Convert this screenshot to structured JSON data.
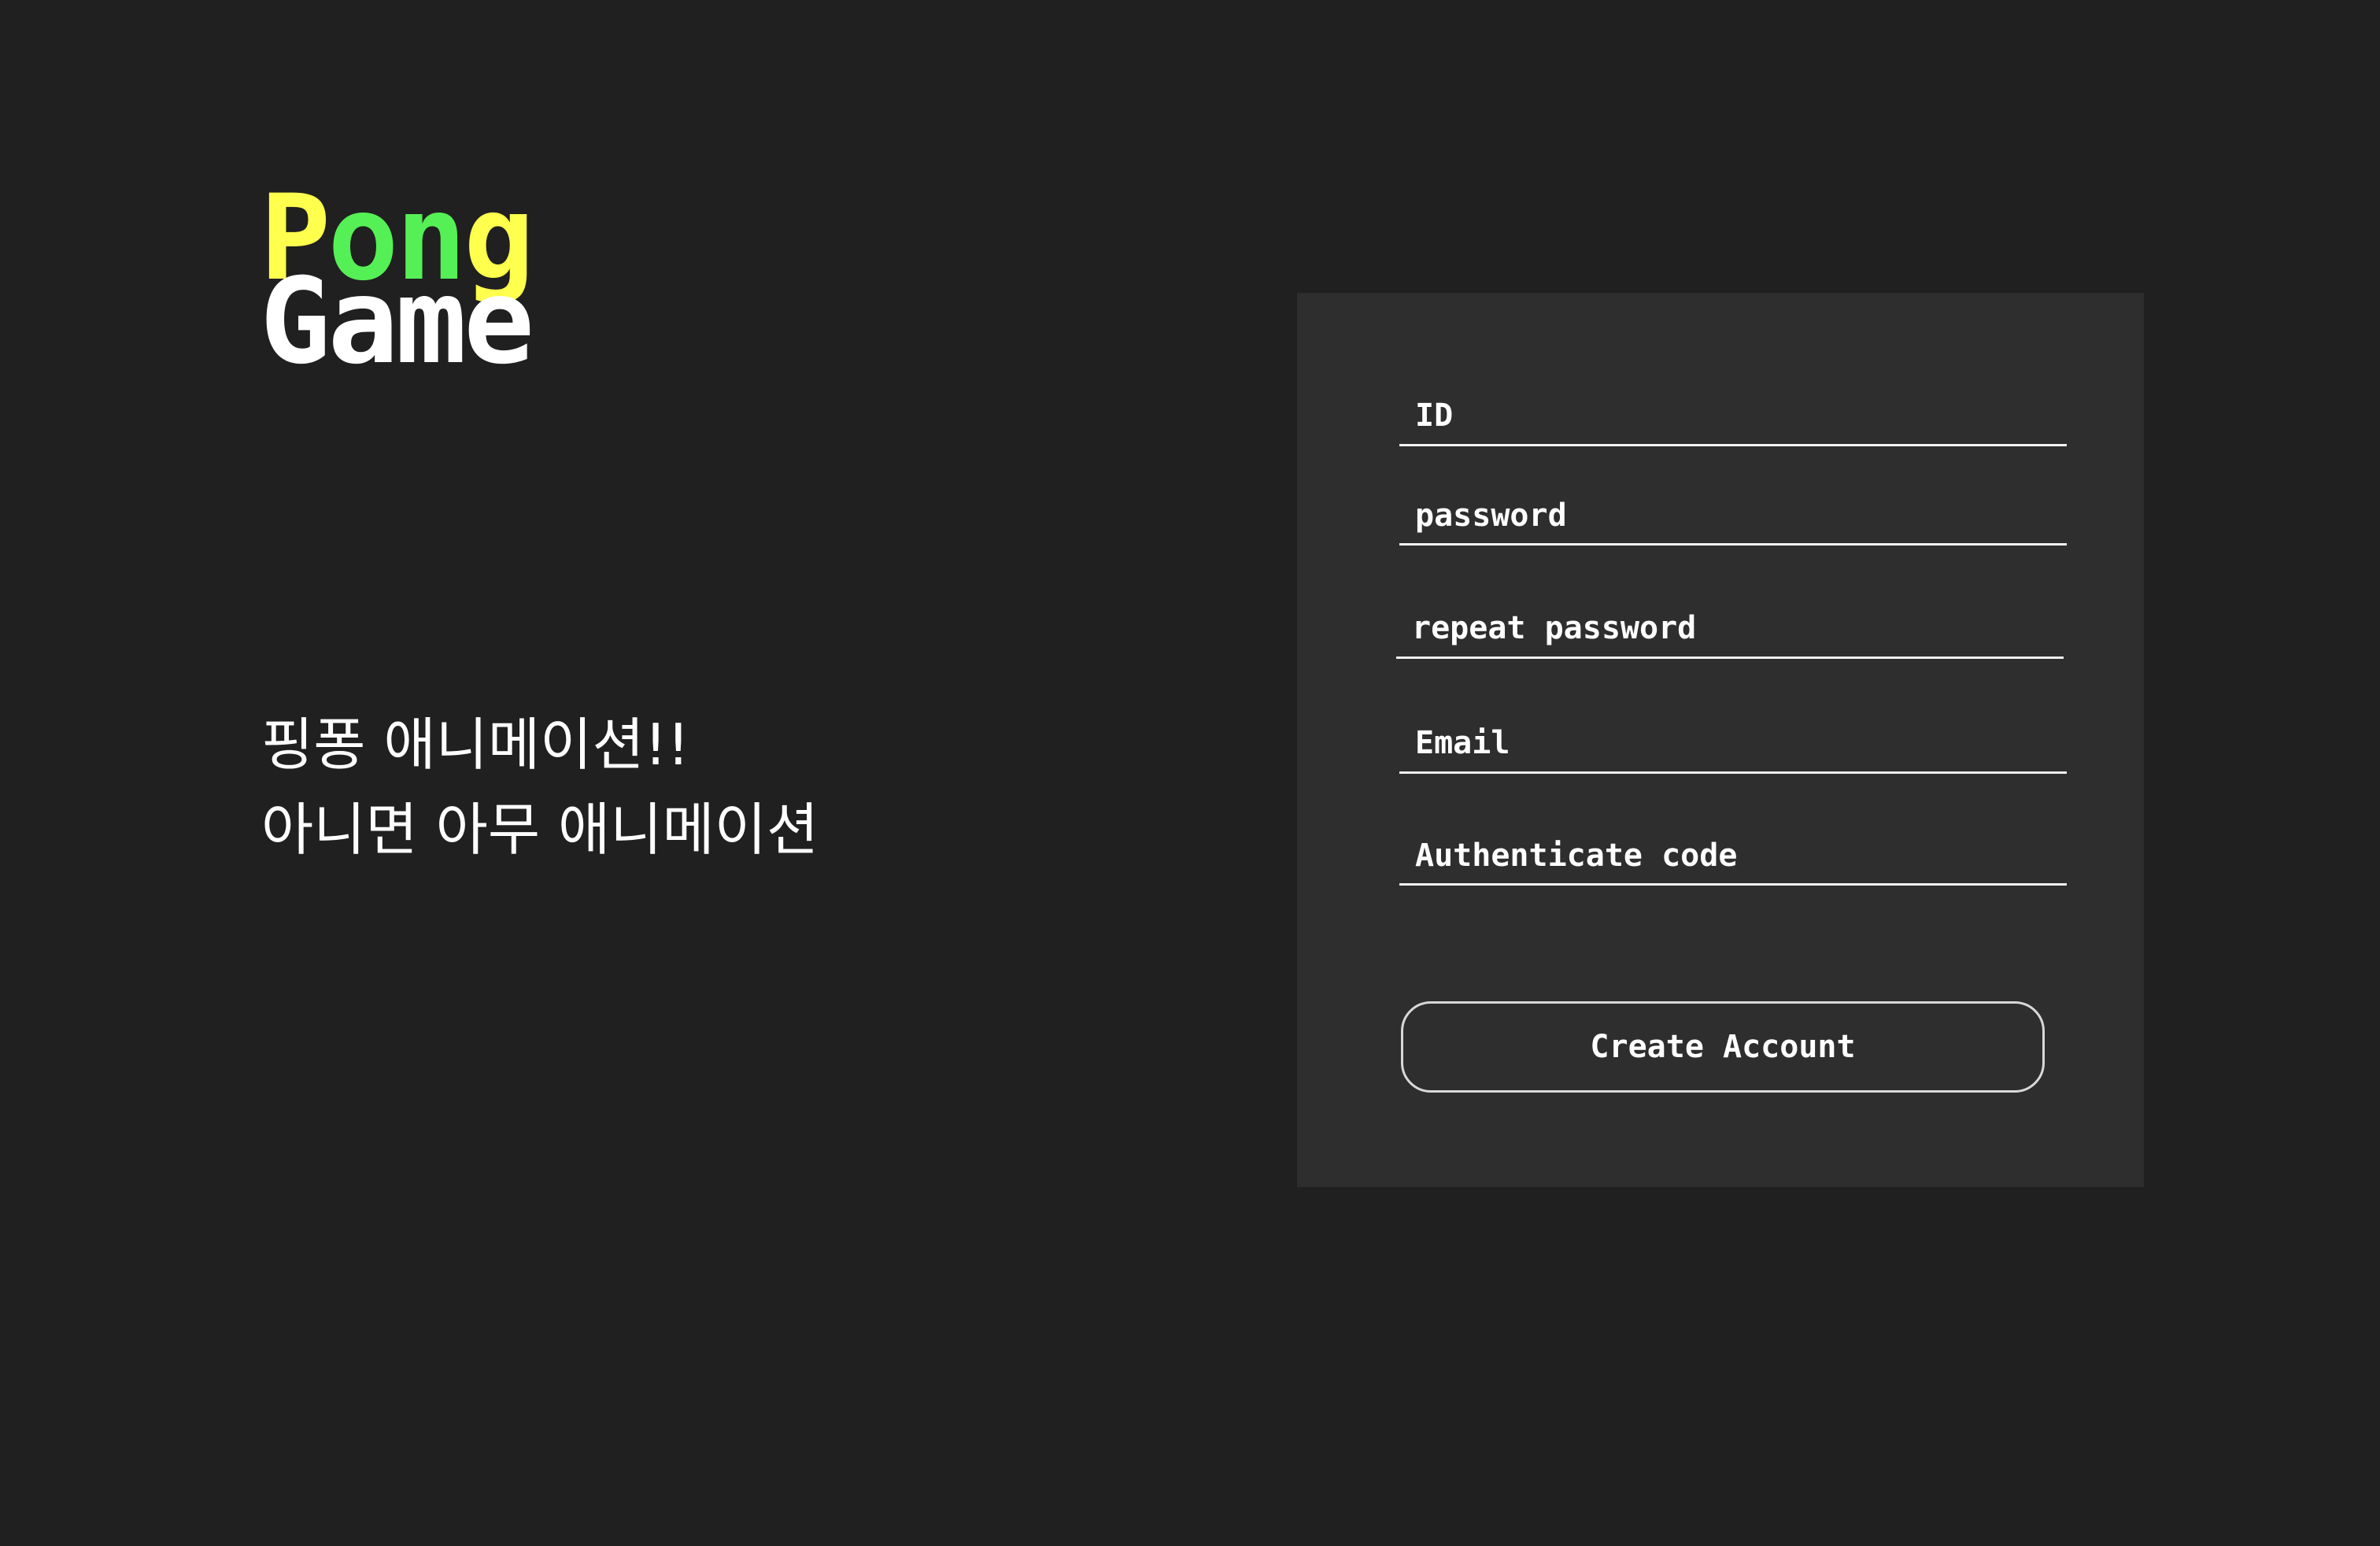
{
  "logo": {
    "line1": [
      "P",
      "o",
      "n",
      "g"
    ],
    "line1_colors": [
      "#ffff4d",
      "#55f055",
      "#55f055",
      "#ffff4d"
    ],
    "line2": "Game"
  },
  "tagline": {
    "line1": "핑퐁 애니메이션!!",
    "line2": "아니면 아무 애니메이션"
  },
  "form": {
    "id_placeholder": "ID",
    "password_placeholder": "password",
    "repeat_password_placeholder": "repeat password",
    "email_placeholder": "Email",
    "auth_code_placeholder": "Authenticate code",
    "submit_label": "Create Account"
  },
  "colors": {
    "background": "#202020",
    "panel": "#2e2e2e",
    "yellow": "#ffff4d",
    "green": "#55f055",
    "text": "#ffffff"
  }
}
